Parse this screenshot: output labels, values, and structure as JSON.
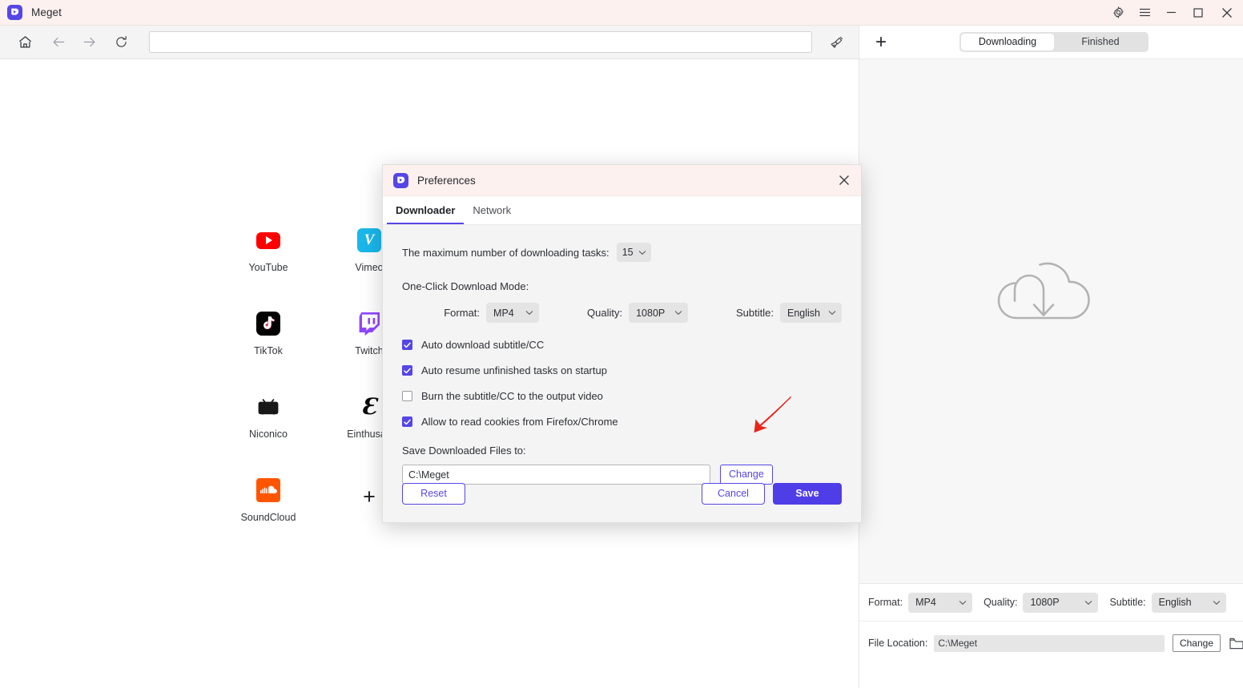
{
  "window": {
    "title": "Meget",
    "logo_icon": "meget-logo-icon",
    "controls": [
      {
        "name": "settings-gear",
        "icon": "gear-icon"
      },
      {
        "name": "menu",
        "icon": "hamburger-menu-icon"
      },
      {
        "name": "minimize",
        "icon": "minimize-icon"
      },
      {
        "name": "maximize",
        "icon": "maximize-icon"
      },
      {
        "name": "close",
        "icon": "close-icon"
      }
    ]
  },
  "toolbar": {
    "home_icon": "home-icon",
    "back_icon": "arrow-left-icon",
    "forward_icon": "arrow-right-icon",
    "reload_icon": "reload-icon",
    "clean_icon": "broom-icon",
    "url_value": "",
    "url_placeholder": ""
  },
  "sites": [
    {
      "label": "YouTube",
      "icon": "youtube-icon"
    },
    {
      "label": "Vimeo",
      "icon": "vimeo-icon"
    },
    {
      "label": "TikTok",
      "icon": "tiktok-icon"
    },
    {
      "label": "Twitch",
      "icon": "twitch-icon"
    },
    {
      "label": "Niconico",
      "icon": "niconico-icon"
    },
    {
      "label": "Einthusan",
      "icon": "einthusan-icon"
    },
    {
      "label": "SoundCloud",
      "icon": "soundcloud-icon"
    },
    {
      "label": "+",
      "icon": "plus-icon"
    }
  ],
  "right_panel": {
    "add_icon": "plus-icon",
    "tabs": [
      {
        "label": "Downloading",
        "active": true
      },
      {
        "label": "Finished",
        "active": false
      }
    ],
    "empty_icon": "cloud-download-icon",
    "format_label": "Format:",
    "format_value": "MP4",
    "quality_label": "Quality:",
    "quality_value": "1080P",
    "subtitle_label": "Subtitle:",
    "subtitle_value": "English",
    "file_location_label": "File Location:",
    "file_location_value": "C:\\Meget",
    "change_label": "Change",
    "folder_icon": "folder-icon"
  },
  "dialog": {
    "title": "Preferences",
    "logo_icon": "meget-logo-icon",
    "close_icon": "close-icon",
    "tabs": [
      {
        "label": "Downloader",
        "active": true
      },
      {
        "label": "Network",
        "active": false
      }
    ],
    "max_tasks_label": "The maximum number of downloading tasks:",
    "max_tasks_value": "15",
    "one_click_label": "One-Click Download Mode:",
    "format_label": "Format:",
    "format_value": "MP4",
    "quality_label": "Quality:",
    "quality_value": "1080P",
    "subtitle_label": "Subtitle:",
    "subtitle_value": "English",
    "checkboxes": [
      {
        "label": "Auto download subtitle/CC",
        "checked": true
      },
      {
        "label": "Auto resume unfinished tasks on startup",
        "checked": true
      },
      {
        "label": "Burn the subtitle/CC to the output video",
        "checked": false
      },
      {
        "label": "Allow to read cookies from Firefox/Chrome",
        "checked": true
      }
    ],
    "save_to_label": "Save Downloaded Files to:",
    "save_to_value": "C:\\Meget",
    "change_label": "Change",
    "reset_label": "Reset",
    "cancel_label": "Cancel",
    "save_label": "Save"
  },
  "annotation": {
    "arrow_icon": "red-arrow-annotation",
    "color": "#e8251b"
  },
  "colors": {
    "accent": "#5546e6",
    "save_button": "#4f3de8",
    "titlebar": "#fcf1ee",
    "dialog_bg": "#f4f4f4"
  }
}
